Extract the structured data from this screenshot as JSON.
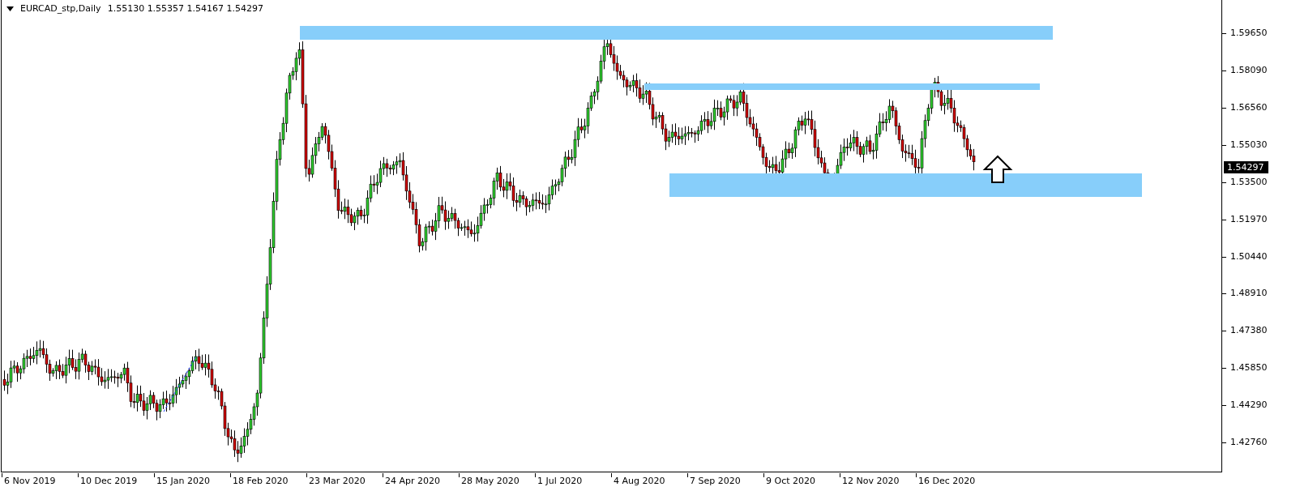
{
  "chart": {
    "symbol": "EURCAD_stp,Daily",
    "ohlc": [
      "1.55130",
      "1.55357",
      "1.54167",
      "1.54297"
    ],
    "price_axis": [
      "1.59650",
      "1.58090",
      "1.56560",
      "1.55030",
      "1.53500",
      "1.51970",
      "1.50440",
      "1.48910",
      "1.47380",
      "1.45850",
      "1.44290",
      "1.42760"
    ],
    "current_price": "1.54297",
    "time_axis": [
      "6 Nov 2019",
      "10 Dec 2019",
      "15 Jan 2020",
      "18 Feb 2020",
      "23 Mar 2020",
      "24 Apr 2020",
      "28 May 2020",
      "1 Jul 2020",
      "4 Aug 2020",
      "7 Sep 2020",
      "9 Oct 2020",
      "12 Nov 2020",
      "16 Dec 2020"
    ]
  }
}
